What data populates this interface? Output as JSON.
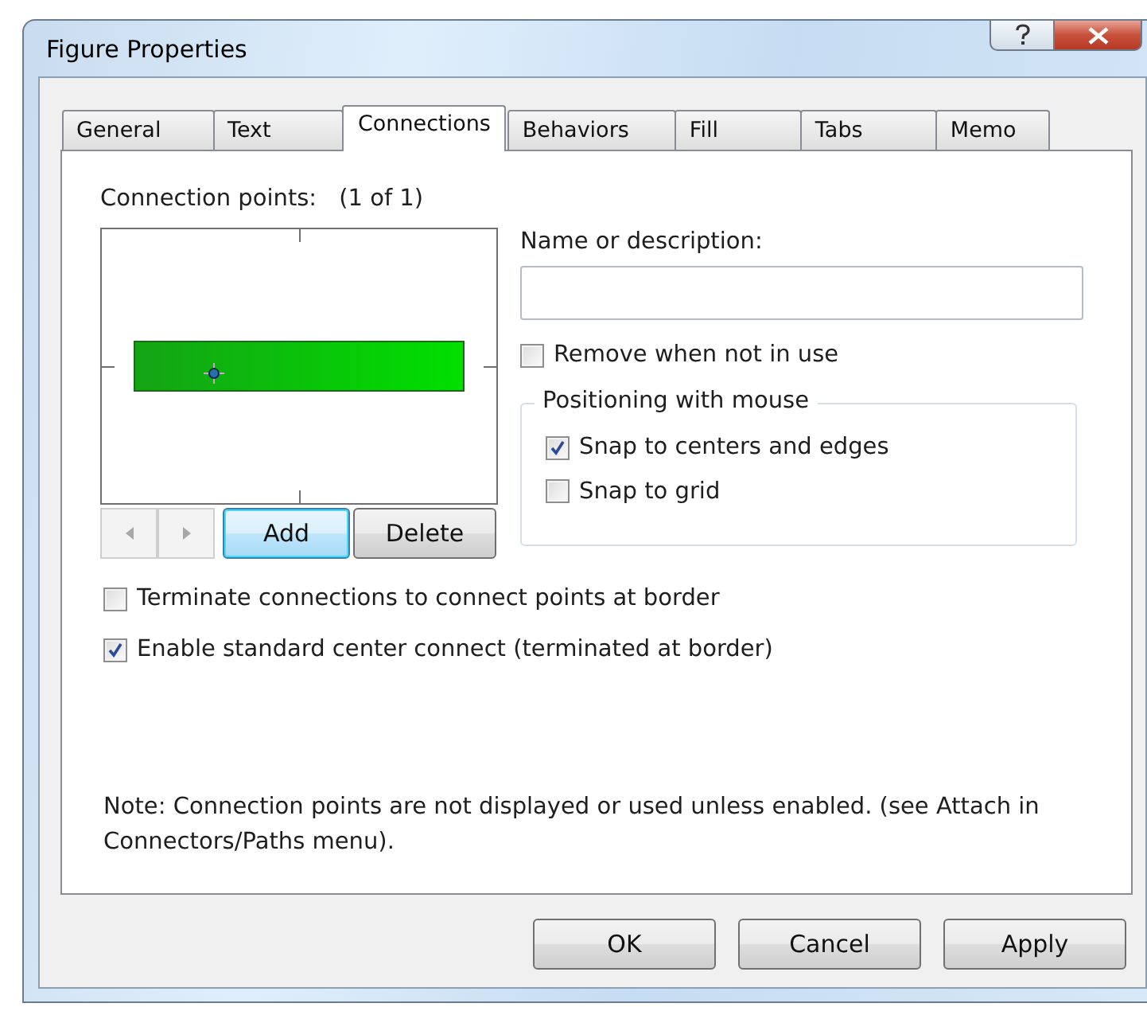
{
  "window": {
    "title": "Figure Properties"
  },
  "tabs": [
    {
      "label": "General",
      "selected": false
    },
    {
      "label": "Text",
      "selected": false
    },
    {
      "label": "Connections",
      "selected": true
    },
    {
      "label": "Behaviors",
      "selected": false
    },
    {
      "label": "Fill",
      "selected": false
    },
    {
      "label": "Tabs",
      "selected": false
    },
    {
      "label": "Memo",
      "selected": false
    }
  ],
  "connection_points": {
    "label": "Connection points:",
    "counter": "(1 of 1)",
    "nav_buttons": [
      {
        "kind": "previous",
        "disabled": true
      },
      {
        "kind": "next",
        "disabled": true
      }
    ],
    "buttons": [
      {
        "label": "Add",
        "focused": true
      },
      {
        "label": "Delete",
        "focused": false
      }
    ]
  },
  "name_field": {
    "label": "Name or description:"
  },
  "remove_when_unused": {
    "label": "Remove when not in use",
    "checked": false
  },
  "positioning_group": {
    "title": "Positioning with mouse",
    "options": [
      {
        "label": "Snap to centers and edges",
        "checked": true
      },
      {
        "label": "Snap to grid",
        "checked": false
      }
    ]
  },
  "options": [
    {
      "label": "Terminate connections to connect points at border",
      "checked": false
    },
    {
      "label": "Enable standard center connect (terminated at border)",
      "checked": true
    }
  ],
  "note": "Note: Connection points are not displayed or used unless enabled.  (see Attach in Connectors/Paths menu).",
  "buttons": [
    {
      "label": "OK"
    },
    {
      "label": "Cancel"
    },
    {
      "label": "Apply"
    }
  ]
}
